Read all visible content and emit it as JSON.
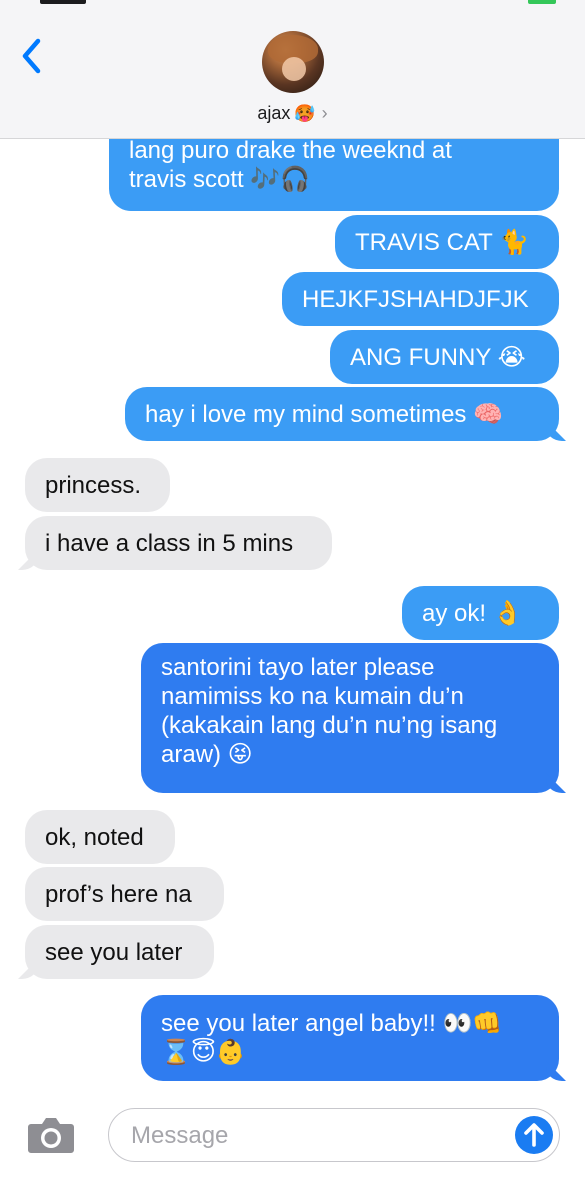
{
  "header": {
    "contact_name": "ajax",
    "name_emoji": "🥵",
    "details_chevron": "›",
    "icons": {
      "back": "chevron-left-icon",
      "avatar": "contact-avatar"
    },
    "accent": "#007aff"
  },
  "messages": [
    {
      "side": "sent",
      "lines": [
        "lang puro drake the weeknd at",
        "travis scott 🎶🎧"
      ]
    },
    {
      "side": "sent",
      "text": "TRAVIS CAT 🐈"
    },
    {
      "side": "sent",
      "text": "HEJKFJSHAHDJFJK"
    },
    {
      "side": "sent",
      "text": "ANG FUNNY 😭"
    },
    {
      "side": "sent",
      "text": "hay i love my mind sometimes 🧠"
    },
    {
      "side": "received",
      "text": "princess."
    },
    {
      "side": "received",
      "text": "i have a class in 5 mins"
    },
    {
      "side": "sent",
      "text": "ay ok! 👌"
    },
    {
      "side": "sent",
      "lines": [
        "santorini tayo later please",
        "namimiss ko na kumain du’n",
        "(kakakain lang du’n nu’ng isang",
        "araw) 😝"
      ]
    },
    {
      "side": "received",
      "text": "ok, noted"
    },
    {
      "side": "received",
      "text": "prof’s here na"
    },
    {
      "side": "received",
      "text": "see you later"
    },
    {
      "side": "sent",
      "lines": [
        "see you later angel baby!! 👀👊",
        "⌛😇👶"
      ]
    }
  ],
  "composer": {
    "placeholder": "Message",
    "icons": {
      "camera": "camera-icon",
      "send": "send-arrow-icon"
    }
  },
  "colors": {
    "sent_bubble": "#3b9cf5",
    "sent_bubble_dark": "#2f7cf0",
    "received_bubble": "#e9e9eb",
    "header_bg": "#f5f5f7"
  }
}
